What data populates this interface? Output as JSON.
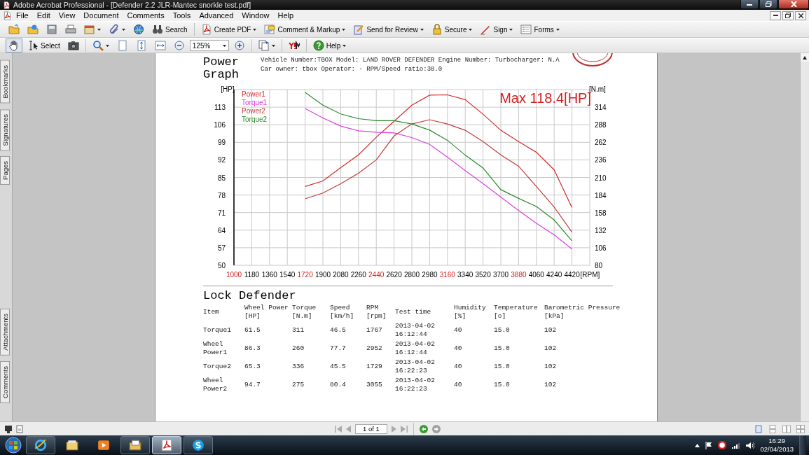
{
  "window": {
    "title": "Adobe Acrobat Professional - [Defender 2.2 JLR-Mantec snorkle test.pdf]"
  },
  "menu": [
    "File",
    "Edit",
    "View",
    "Document",
    "Comments",
    "Tools",
    "Advanced",
    "Window",
    "Help"
  ],
  "toolbar_1": [
    {
      "menu": false
    },
    {
      "menu": false
    },
    {
      "menu": false
    },
    {
      "menu": false
    },
    {
      "menu": true
    },
    {
      "menu": true
    },
    {
      "menu": false
    },
    {
      "label": "Search",
      "menu": false
    },
    {
      "label": "Create PDF",
      "menu": true
    },
    {
      "label": "Comment & Markup",
      "menu": true
    },
    {
      "label": "Send for Review",
      "menu": true
    },
    {
      "label": "Secure",
      "menu": true
    },
    {
      "label": "Sign",
      "menu": true
    },
    {
      "label": "Forms",
      "menu": true
    }
  ],
  "toolbar_2": [
    {
      "kind": "button",
      "selected": true,
      "menu": false
    },
    {
      "kind": "button",
      "label": "Select",
      "selected": false,
      "menu": false
    },
    {
      "kind": "button",
      "selected": false,
      "menu": false
    },
    {
      "kind": "button",
      "selected": false,
      "menu": true
    },
    {
      "kind": "button",
      "selected": false,
      "menu": false
    },
    {
      "kind": "button",
      "selected": false,
      "menu": false
    },
    {
      "kind": "button",
      "selected": false,
      "menu": false
    },
    {
      "kind": "button",
      "selected": false,
      "menu": false
    },
    {
      "kind": "field",
      "value": "125%",
      "menu": true
    },
    {
      "kind": "button",
      "selected": false,
      "menu": false
    },
    {
      "kind": "button",
      "selected": false,
      "menu": true
    },
    {
      "kind": "button",
      "selected": false,
      "menu": false
    },
    {
      "kind": "button",
      "label": "Help",
      "selected": false,
      "menu": true
    }
  ],
  "side_tabs": [
    {
      "label": "Bookmarks",
      "kind": "top"
    },
    {
      "label": "Signatures",
      "kind": "top"
    },
    {
      "label": "Pages",
      "kind": "top"
    },
    {
      "label": "Attachments",
      "kind": "bottom"
    },
    {
      "label": "Comments",
      "kind": "bottom"
    }
  ],
  "document": {
    "title": "Power Graph",
    "info": [
      "Vehicle Number:TBOX Model: LAND ROVER DEFENDER Engine Number:  Turbocharger: N.A",
      "Car owner: tbox Operator: - RPM/Speed ratio:38.0"
    ],
    "chart_data": {
      "type": "line",
      "ylabel": "[HP]",
      "xlabel": "[RPM]",
      "y2label": "[N.m]",
      "grid": true,
      "x": [
        1720,
        1900,
        2080,
        2260,
        2440,
        2620,
        2800,
        2980,
        3160,
        3340,
        3520,
        3700,
        3880,
        4060,
        4240,
        4420
      ],
      "xticks": [
        1000,
        1180,
        1360,
        1540,
        1720,
        1900,
        2080,
        2260,
        2440,
        2620,
        2800,
        2980,
        3160,
        3340,
        3520,
        3700,
        3880,
        4060,
        4240,
        4420
      ],
      "xlim": [
        1000,
        4600
      ],
      "ylim": [
        50,
        120
      ],
      "yticks": [
        50,
        57,
        64,
        71,
        78,
        85,
        92,
        99,
        106,
        113
      ],
      "y2ticks": [
        80,
        106,
        132,
        158,
        184,
        210,
        236,
        262,
        288,
        314
      ],
      "y2lim": [
        80,
        340
      ],
      "annotations": [
        "Max 118.4[HP]"
      ],
      "series": [
        {
          "name": "Power1",
          "color": "#d42a2a",
          "values": [
            81.4,
            83.6,
            88.9,
            94,
            101,
            107.4,
            113.8,
            117.8,
            117.9,
            116,
            110.2,
            103.8,
            99.3,
            95,
            88,
            73
          ]
        },
        {
          "name": "Torque1",
          "color": "#e03ce0",
          "axis": "y2",
          "values": [
            312,
            298,
            286,
            279,
            277,
            276,
            269,
            259,
            240,
            220,
            201,
            181,
            161,
            142,
            125,
            104
          ]
        },
        {
          "name": "Power2",
          "color": "#c43c3c",
          "values": [
            76.5,
            78.8,
            82.5,
            86.7,
            92,
            101.5,
            106.3,
            108,
            106.3,
            103.8,
            99.3,
            94,
            89.5,
            81.4,
            73.2,
            63.2
          ]
        },
        {
          "name": "Torque2",
          "color": "#2e8b2e",
          "axis": "y2",
          "values": [
            336,
            317,
            304,
            297,
            294,
            294,
            289,
            280,
            265,
            243,
            224,
            192,
            179,
            167,
            147,
            116
          ]
        }
      ]
    },
    "section_title": "Lock Defender",
    "table": {
      "columns": [
        {
          "label": "Item"
        },
        {
          "label": "Wheel Power",
          "unit": "[HP]"
        },
        {
          "label": "Torque",
          "unit": "[N.m]"
        },
        {
          "label": "Speed",
          "unit": "[km/h]"
        },
        {
          "label": "RPM",
          "unit": "[rpm]"
        },
        {
          "label": "Test time"
        },
        {
          "label": "Humidity",
          "unit": "[%]"
        },
        {
          "label": "Temperature",
          "unit": "[o]"
        },
        {
          "label": "Barometric Pressure",
          "unit": "[kPa]"
        }
      ],
      "rows": [
        [
          "Torque1",
          "61.5",
          "311",
          "46.5",
          "1767",
          "2013-04-02 16:12:44",
          "40",
          "15.0",
          "102"
        ],
        [
          "Wheel Power1",
          "86.3",
          "260",
          "77.7",
          "2952",
          "2013-04-02 16:12:44",
          "40",
          "15.0",
          "102"
        ],
        [
          "Torque2",
          "65.3",
          "336",
          "45.5",
          "1729",
          "2013-04-02 16:22:23",
          "40",
          "15.0",
          "102"
        ],
        [
          "Wheel Power2",
          "94.7",
          "275",
          "80.4",
          "3055",
          "2013-04-02 16:22:23",
          "40",
          "15.0",
          "102"
        ]
      ]
    }
  },
  "page_nav": {
    "page": "1 of 1"
  },
  "taskbar": {
    "apps": [
      {
        "running": true,
        "selected": false
      },
      {
        "running": false,
        "selected": false
      },
      {
        "running": false,
        "selected": false
      },
      {
        "running": true,
        "selected": false
      },
      {
        "running": true,
        "selected": true
      },
      {
        "running": true,
        "selected": false
      }
    ],
    "clock": {
      "time": "16:29",
      "date": "02/04/2013"
    }
  }
}
